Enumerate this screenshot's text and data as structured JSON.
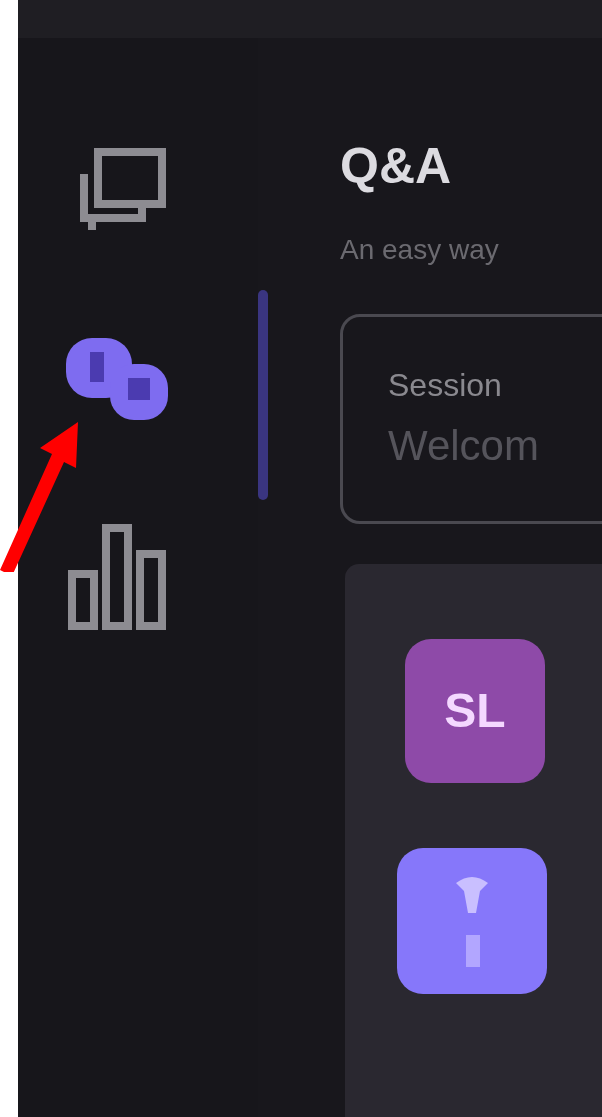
{
  "sidebar": {
    "items": [
      {
        "kind": "chat",
        "selected": false
      },
      {
        "kind": "qa",
        "selected": true
      },
      {
        "kind": "poll",
        "selected": false
      }
    ]
  },
  "header": {
    "title": "Q&A",
    "subtitle": "An easy way"
  },
  "session": {
    "label": "Session",
    "value": "Welcom"
  },
  "questions": [
    {
      "kind": "avatar",
      "initials": "SL"
    },
    {
      "kind": "question"
    }
  ]
}
